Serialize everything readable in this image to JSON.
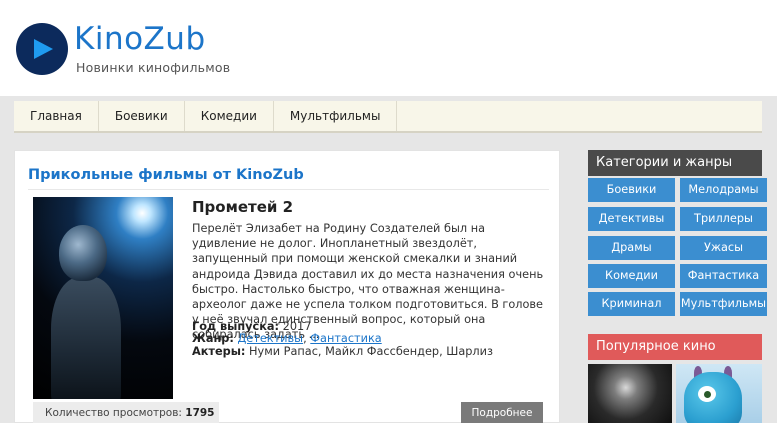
{
  "header": {
    "logo_title": "KinoZub",
    "logo_subtitle": "Новинки кинофильмов",
    "brand_color": "#1c75c9",
    "logo_circle_color": "#0c2a5c"
  },
  "nav": {
    "items": [
      "Главная",
      "Боевики",
      "Комедии",
      "Мультфильмы"
    ]
  },
  "main": {
    "section_title": "Прикольные фильмы от KinoZub",
    "movie": {
      "title": "Прометей 2",
      "description": "Перелёт Элизабет на Родину Создателей был на удивление не долог. Инопланетный звездолёт, запущенный при помощи женской смекалки и знаний андроида Дэвида доставил их до места назначения очень быстро. Настолько быстро, что отважная женщина-археолог даже не успела толком подготовиться. В голове у неё звучал единственный вопрос, который она собиралась задать ...",
      "year_label": "Год выпуска:",
      "year": "2017",
      "genre_label": "Жанр:",
      "genres": [
        "Детективы",
        "Фантастика"
      ],
      "actors_label": "Актеры:",
      "actors": "Нуми Рапас, Майкл Фассбендер, Шарлиз",
      "views_label": "Количество просмотров:",
      "views": "1795",
      "more_button": "Подробнее"
    }
  },
  "sidebar": {
    "categories_title": "Категории и жанры",
    "categories": [
      "Боевики",
      "Мелодрамы",
      "Детективы",
      "Триллеры",
      "Драмы",
      "Ужасы",
      "Комедии",
      "Фантастика",
      "Криминал",
      "Мультфильмы"
    ],
    "popular_title": "Популярное кино",
    "category_color": "#3b8ed0",
    "popular_color": "#e05a5a"
  }
}
